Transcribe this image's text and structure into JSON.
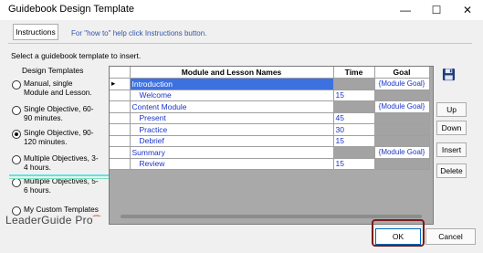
{
  "window": {
    "title": "Guidebook Design Template",
    "minimize_glyph": "—",
    "maximize_glyph": "☐",
    "close_glyph": "✕"
  },
  "toolbar": {
    "instructions_label": "Instructions",
    "howto_text": "For \"how to\" help click Instructions button."
  },
  "select_label": "Select a guidebook template to insert.",
  "design_templates": {
    "title": "Design Templates",
    "options": [
      {
        "label": "Manual, single Module and Lesson.",
        "selected": false
      },
      {
        "label": "Single Objective, 60-90 minutes.",
        "selected": false
      },
      {
        "label": "Single Objective, 90-120 minutes.",
        "selected": true
      },
      {
        "label": "Multiple Objectives, 3-4 hours.",
        "selected": false
      },
      {
        "label": "Multiple Objectives, 5-6 hours.",
        "selected": false
      },
      {
        "label": "My Custom Templates",
        "selected": false
      }
    ]
  },
  "grid": {
    "headers": {
      "name": "Module and Lesson Names",
      "time": "Time",
      "goal": "Goal"
    },
    "rows": [
      {
        "indicator": "▸",
        "name": "Introduction",
        "time": "",
        "goal": "{Module Goal}",
        "level": 0,
        "selected": true
      },
      {
        "indicator": "",
        "name": "Welcome",
        "time": "15",
        "goal": "",
        "level": 1,
        "selected": false
      },
      {
        "indicator": "",
        "name": "Content Module",
        "time": "",
        "goal": "{Module Goal}",
        "level": 0,
        "selected": false
      },
      {
        "indicator": "",
        "name": "Present",
        "time": "45",
        "goal": "",
        "level": 1,
        "selected": false
      },
      {
        "indicator": "",
        "name": "Practice",
        "time": "30",
        "goal": "",
        "level": 1,
        "selected": false
      },
      {
        "indicator": "",
        "name": "Debrief",
        "time": "15",
        "goal": "",
        "level": 1,
        "selected": false
      },
      {
        "indicator": "",
        "name": "Summary",
        "time": "",
        "goal": "{Module Goal}",
        "level": 0,
        "selected": false
      },
      {
        "indicator": "",
        "name": "Review",
        "time": "15",
        "goal": "",
        "level": 1,
        "selected": false
      }
    ]
  },
  "side_buttons": {
    "up": "Up",
    "down": "Down",
    "insert": "Insert",
    "delete": "Delete"
  },
  "logo": {
    "text": "LeaderGuide Pro"
  },
  "footer": {
    "ok": "OK",
    "cancel": "Cancel"
  },
  "colors": {
    "selection": "#3d71e0",
    "link_text": "#1a35c8",
    "ok_highlight": "#7d1a1a"
  }
}
